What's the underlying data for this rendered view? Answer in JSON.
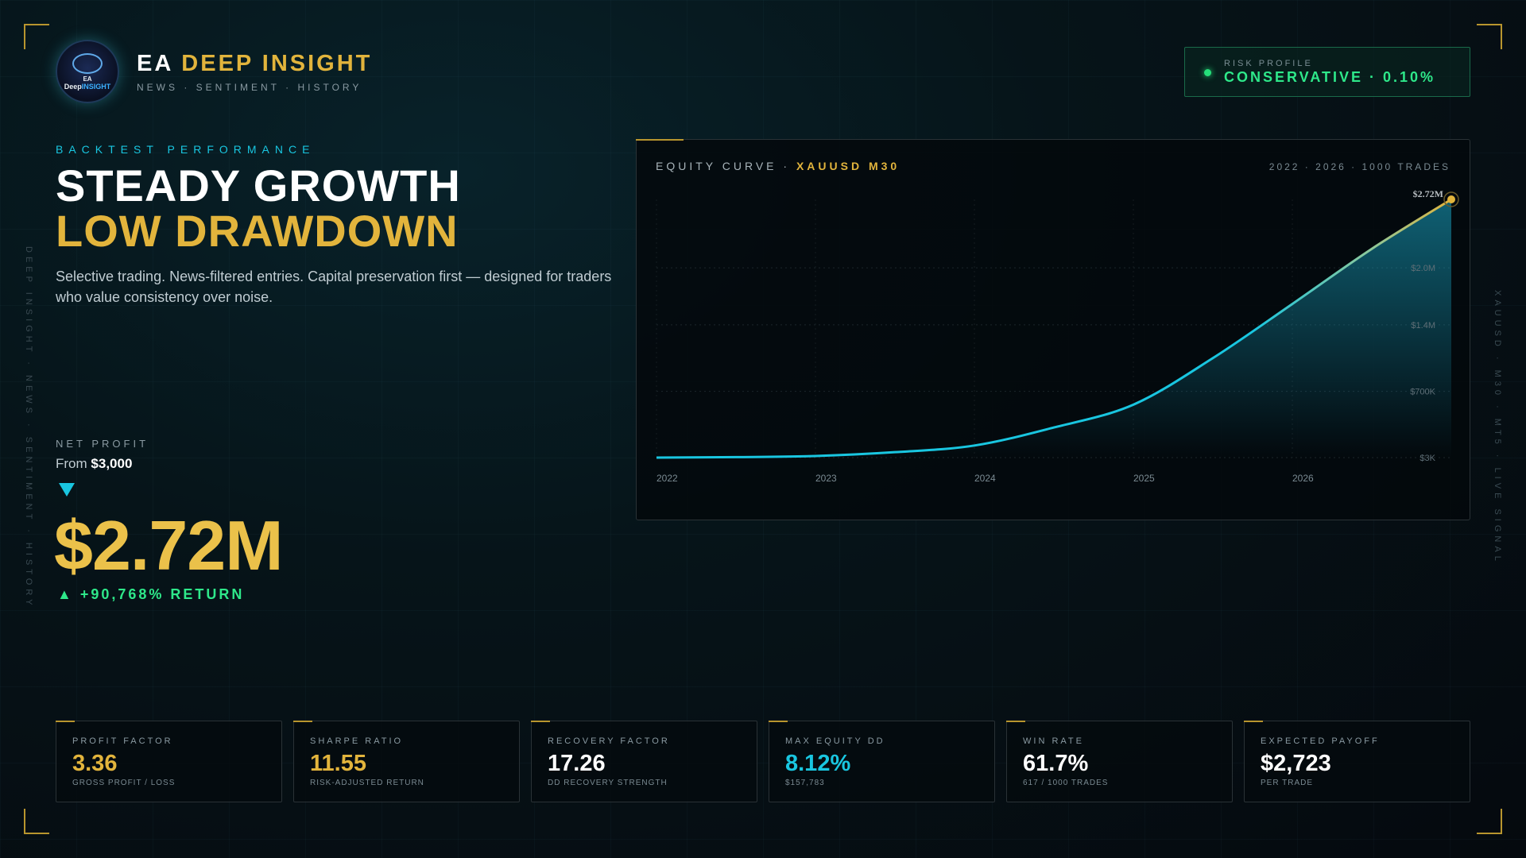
{
  "header": {
    "brand_prefix": "EA",
    "brand_highlight": "DEEP INSIGHT",
    "brand_sub": "NEWS · SENTIMENT · HISTORY",
    "logo_ea": "EA",
    "logo_name_a": "Deep",
    "logo_name_b": "INSIGHT"
  },
  "risk": {
    "label": "RISK PROFILE",
    "value": "CONSERVATIVE · 0.10%"
  },
  "side": {
    "left": "DEEP INSIGHT · NEWS · SENTIMENT · HISTORY",
    "right": "XAUUSD · M30 · MT5 · LIVE SIGNAL"
  },
  "hero": {
    "kicker": "BACKTEST PERFORMANCE",
    "line1": "STEADY GROWTH",
    "line2": "LOW DRAWDOWN",
    "description": "Selective trading. News-filtered entries. Capital preservation first — designed for traders who value consistency over noise."
  },
  "net_profit": {
    "label": "NET PROFIT",
    "from_prefix": "From",
    "from_value": "$3,000",
    "value": "$2.72M",
    "return": "▲  +90,768% RETURN"
  },
  "chart": {
    "title_prefix": "EQUITY CURVE ·",
    "title_symbol": "XAUUSD M30",
    "meta": "2022 · 2026 · 1000 TRADES"
  },
  "chart_data": {
    "type": "area",
    "title": "EQUITY CURVE · XAUUSD M30",
    "x_ticks": [
      "2022",
      "2023",
      "2024",
      "2025",
      "2026"
    ],
    "y_ticks": [
      "$3K",
      "$700K",
      "$1.4M",
      "$2.0M"
    ],
    "end_label": "$2.72M",
    "x": [
      2022.0,
      2022.5,
      2023.0,
      2023.5,
      2024.0,
      2024.5,
      2025.0,
      2025.5,
      2026.0,
      2026.5,
      2027.0
    ],
    "y": [
      3000,
      8000,
      20000,
      60000,
      130000,
      320000,
      560000,
      1050000,
      1620000,
      2200000,
      2720000
    ],
    "ylim": [
      3000,
      2720000
    ],
    "xlim": [
      2022,
      2027
    ],
    "grid": true
  },
  "stats": [
    {
      "label": "PROFIT FACTOR",
      "value": "3.36",
      "sub": "GROSS PROFIT / LOSS",
      "color": "#e2b43c"
    },
    {
      "label": "SHARPE RATIO",
      "value": "11.55",
      "sub": "RISK-ADJUSTED RETURN",
      "color": "#e2b43c"
    },
    {
      "label": "RECOVERY FACTOR",
      "value": "17.26",
      "sub": "DD RECOVERY STRENGTH",
      "color": "#ffffff"
    },
    {
      "label": "MAX EQUITY DD",
      "value": "8.12%",
      "sub": "$157,783",
      "color": "#19c6e0"
    },
    {
      "label": "WIN RATE",
      "value": "61.7%",
      "sub": "617 / 1000 TRADES",
      "color": "#ffffff"
    },
    {
      "label": "EXPECTED PAYOFF",
      "value": "$2,723",
      "sub": "PER TRADE",
      "color": "#ffffff"
    }
  ]
}
